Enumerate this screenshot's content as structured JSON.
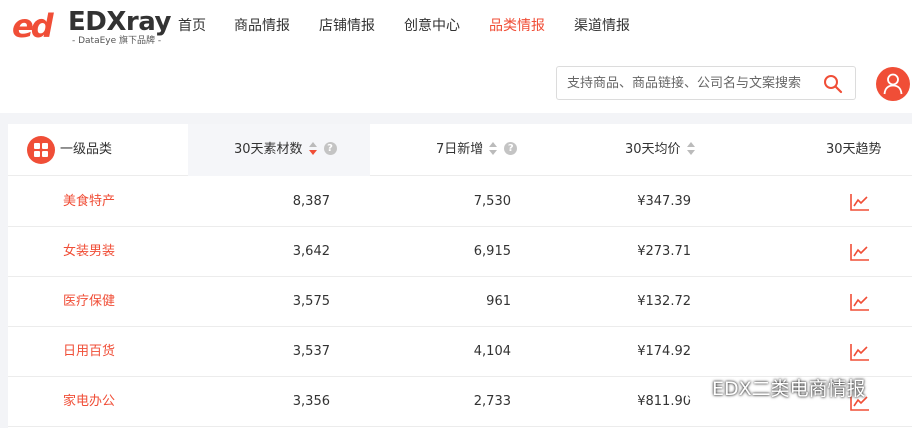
{
  "brand": {
    "logo_mark": "ed",
    "name": "EDXray",
    "tagline": "- DataEye 旗下品牌 -",
    "accent_color": "#f04e37"
  },
  "nav": {
    "items": [
      {
        "label": "首页",
        "active": false
      },
      {
        "label": "商品情报",
        "active": false
      },
      {
        "label": "店铺情报",
        "active": false
      },
      {
        "label": "创意中心",
        "active": false
      },
      {
        "label": "品类情报",
        "active": true
      },
      {
        "label": "渠道情报",
        "active": false
      }
    ]
  },
  "search": {
    "placeholder": "支持商品、商品链接、公司名与文案搜索",
    "value": ""
  },
  "table": {
    "headers": {
      "category": "一级品类",
      "materials_30d": "30天素材数",
      "new_7d": "7日新增",
      "avg_price_30d": "30天均价",
      "trend_30d": "30天趋势"
    },
    "rows": [
      {
        "category": "美食特产",
        "materials_30d": "8,387",
        "new_7d": "7,530",
        "avg_price_30d": "¥347.39"
      },
      {
        "category": "女装男装",
        "materials_30d": "3,642",
        "new_7d": "6,915",
        "avg_price_30d": "¥273.71"
      },
      {
        "category": "医疗保健",
        "materials_30d": "3,575",
        "new_7d": "961",
        "avg_price_30d": "¥132.72"
      },
      {
        "category": "日用百货",
        "materials_30d": "3,537",
        "new_7d": "4,104",
        "avg_price_30d": "¥174.92"
      },
      {
        "category": "家电办公",
        "materials_30d": "3,356",
        "new_7d": "2,733",
        "avg_price_30d": "¥811.90"
      }
    ]
  },
  "icons": {
    "category": "grid-icon",
    "search": "search-icon",
    "avatar": "user-icon",
    "trend": "trend-chart-icon",
    "watermark": "wechat-icon"
  },
  "watermark": {
    "text": "EDX二类电商情报"
  }
}
